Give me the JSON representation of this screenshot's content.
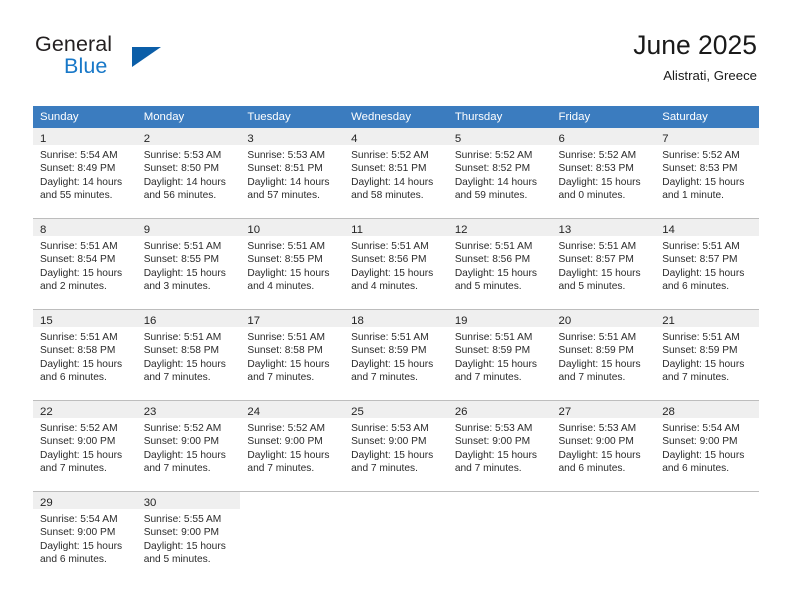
{
  "brand": {
    "name_part1": "General",
    "name_part2": "Blue",
    "triangle_color": "#0b5ea8",
    "text_color_primary": "#231f20",
    "text_color_accent": "#1878c8"
  },
  "header": {
    "title": "June 2025",
    "subtitle": "Alistrati, Greece"
  },
  "theme": {
    "header_row_bg": "#3b7cbf",
    "header_row_text": "#ffffff",
    "daynum_bar_bg": "#efefef",
    "row_separator": "#bdbdbd",
    "page_bg": "#ffffff"
  },
  "calendar": {
    "weekday_headers": [
      "Sunday",
      "Monday",
      "Tuesday",
      "Wednesday",
      "Thursday",
      "Friday",
      "Saturday"
    ],
    "weeks": [
      [
        {
          "day": "1",
          "sunrise": "Sunrise: 5:54 AM",
          "sunset": "Sunset: 8:49 PM",
          "daylight": "Daylight: 14 hours and 55 minutes."
        },
        {
          "day": "2",
          "sunrise": "Sunrise: 5:53 AM",
          "sunset": "Sunset: 8:50 PM",
          "daylight": "Daylight: 14 hours and 56 minutes."
        },
        {
          "day": "3",
          "sunrise": "Sunrise: 5:53 AM",
          "sunset": "Sunset: 8:51 PM",
          "daylight": "Daylight: 14 hours and 57 minutes."
        },
        {
          "day": "4",
          "sunrise": "Sunrise: 5:52 AM",
          "sunset": "Sunset: 8:51 PM",
          "daylight": "Daylight: 14 hours and 58 minutes."
        },
        {
          "day": "5",
          "sunrise": "Sunrise: 5:52 AM",
          "sunset": "Sunset: 8:52 PM",
          "daylight": "Daylight: 14 hours and 59 minutes."
        },
        {
          "day": "6",
          "sunrise": "Sunrise: 5:52 AM",
          "sunset": "Sunset: 8:53 PM",
          "daylight": "Daylight: 15 hours and 0 minutes."
        },
        {
          "day": "7",
          "sunrise": "Sunrise: 5:52 AM",
          "sunset": "Sunset: 8:53 PM",
          "daylight": "Daylight: 15 hours and 1 minute."
        }
      ],
      [
        {
          "day": "8",
          "sunrise": "Sunrise: 5:51 AM",
          "sunset": "Sunset: 8:54 PM",
          "daylight": "Daylight: 15 hours and 2 minutes."
        },
        {
          "day": "9",
          "sunrise": "Sunrise: 5:51 AM",
          "sunset": "Sunset: 8:55 PM",
          "daylight": "Daylight: 15 hours and 3 minutes."
        },
        {
          "day": "10",
          "sunrise": "Sunrise: 5:51 AM",
          "sunset": "Sunset: 8:55 PM",
          "daylight": "Daylight: 15 hours and 4 minutes."
        },
        {
          "day": "11",
          "sunrise": "Sunrise: 5:51 AM",
          "sunset": "Sunset: 8:56 PM",
          "daylight": "Daylight: 15 hours and 4 minutes."
        },
        {
          "day": "12",
          "sunrise": "Sunrise: 5:51 AM",
          "sunset": "Sunset: 8:56 PM",
          "daylight": "Daylight: 15 hours and 5 minutes."
        },
        {
          "day": "13",
          "sunrise": "Sunrise: 5:51 AM",
          "sunset": "Sunset: 8:57 PM",
          "daylight": "Daylight: 15 hours and 5 minutes."
        },
        {
          "day": "14",
          "sunrise": "Sunrise: 5:51 AM",
          "sunset": "Sunset: 8:57 PM",
          "daylight": "Daylight: 15 hours and 6 minutes."
        }
      ],
      [
        {
          "day": "15",
          "sunrise": "Sunrise: 5:51 AM",
          "sunset": "Sunset: 8:58 PM",
          "daylight": "Daylight: 15 hours and 6 minutes."
        },
        {
          "day": "16",
          "sunrise": "Sunrise: 5:51 AM",
          "sunset": "Sunset: 8:58 PM",
          "daylight": "Daylight: 15 hours and 7 minutes."
        },
        {
          "day": "17",
          "sunrise": "Sunrise: 5:51 AM",
          "sunset": "Sunset: 8:58 PM",
          "daylight": "Daylight: 15 hours and 7 minutes."
        },
        {
          "day": "18",
          "sunrise": "Sunrise: 5:51 AM",
          "sunset": "Sunset: 8:59 PM",
          "daylight": "Daylight: 15 hours and 7 minutes."
        },
        {
          "day": "19",
          "sunrise": "Sunrise: 5:51 AM",
          "sunset": "Sunset: 8:59 PM",
          "daylight": "Daylight: 15 hours and 7 minutes."
        },
        {
          "day": "20",
          "sunrise": "Sunrise: 5:51 AM",
          "sunset": "Sunset: 8:59 PM",
          "daylight": "Daylight: 15 hours and 7 minutes."
        },
        {
          "day": "21",
          "sunrise": "Sunrise: 5:51 AM",
          "sunset": "Sunset: 8:59 PM",
          "daylight": "Daylight: 15 hours and 7 minutes."
        }
      ],
      [
        {
          "day": "22",
          "sunrise": "Sunrise: 5:52 AM",
          "sunset": "Sunset: 9:00 PM",
          "daylight": "Daylight: 15 hours and 7 minutes."
        },
        {
          "day": "23",
          "sunrise": "Sunrise: 5:52 AM",
          "sunset": "Sunset: 9:00 PM",
          "daylight": "Daylight: 15 hours and 7 minutes."
        },
        {
          "day": "24",
          "sunrise": "Sunrise: 5:52 AM",
          "sunset": "Sunset: 9:00 PM",
          "daylight": "Daylight: 15 hours and 7 minutes."
        },
        {
          "day": "25",
          "sunrise": "Sunrise: 5:53 AM",
          "sunset": "Sunset: 9:00 PM",
          "daylight": "Daylight: 15 hours and 7 minutes."
        },
        {
          "day": "26",
          "sunrise": "Sunrise: 5:53 AM",
          "sunset": "Sunset: 9:00 PM",
          "daylight": "Daylight: 15 hours and 7 minutes."
        },
        {
          "day": "27",
          "sunrise": "Sunrise: 5:53 AM",
          "sunset": "Sunset: 9:00 PM",
          "daylight": "Daylight: 15 hours and 6 minutes."
        },
        {
          "day": "28",
          "sunrise": "Sunrise: 5:54 AM",
          "sunset": "Sunset: 9:00 PM",
          "daylight": "Daylight: 15 hours and 6 minutes."
        }
      ],
      [
        {
          "day": "29",
          "sunrise": "Sunrise: 5:54 AM",
          "sunset": "Sunset: 9:00 PM",
          "daylight": "Daylight: 15 hours and 6 minutes."
        },
        {
          "day": "30",
          "sunrise": "Sunrise: 5:55 AM",
          "sunset": "Sunset: 9:00 PM",
          "daylight": "Daylight: 15 hours and 5 minutes."
        },
        null,
        null,
        null,
        null,
        null
      ]
    ]
  }
}
